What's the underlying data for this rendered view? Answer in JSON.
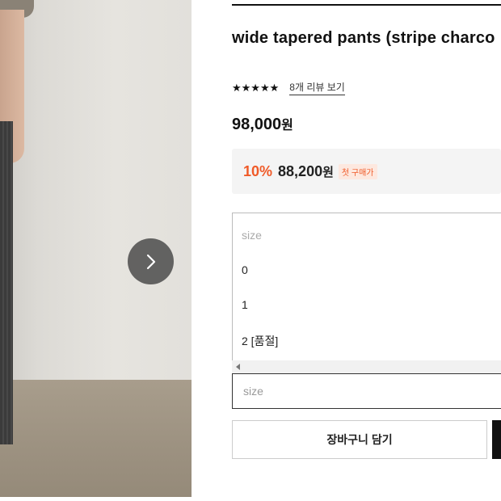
{
  "product": {
    "title": "wide tapered pants (stripe charco",
    "stars": "★★★★★",
    "review_link": "8개 리뷰 보기",
    "price_number": "98,000",
    "price_unit": "원",
    "discount": {
      "percent": "10%",
      "price_number": "88,200",
      "price_unit": "원",
      "badge": "첫 구매가"
    }
  },
  "size_dropdown": {
    "placeholder": "size",
    "options": [
      "0",
      "1",
      "2 [품절]"
    ]
  },
  "size_select": {
    "value": "size"
  },
  "actions": {
    "cart_label": "장바구니 담기"
  },
  "icons": {
    "next": "chevron-right-icon",
    "scroll_left": "scroll-left-arrow-icon"
  },
  "colors": {
    "accent": "#f05a28",
    "dark": "#111111"
  }
}
